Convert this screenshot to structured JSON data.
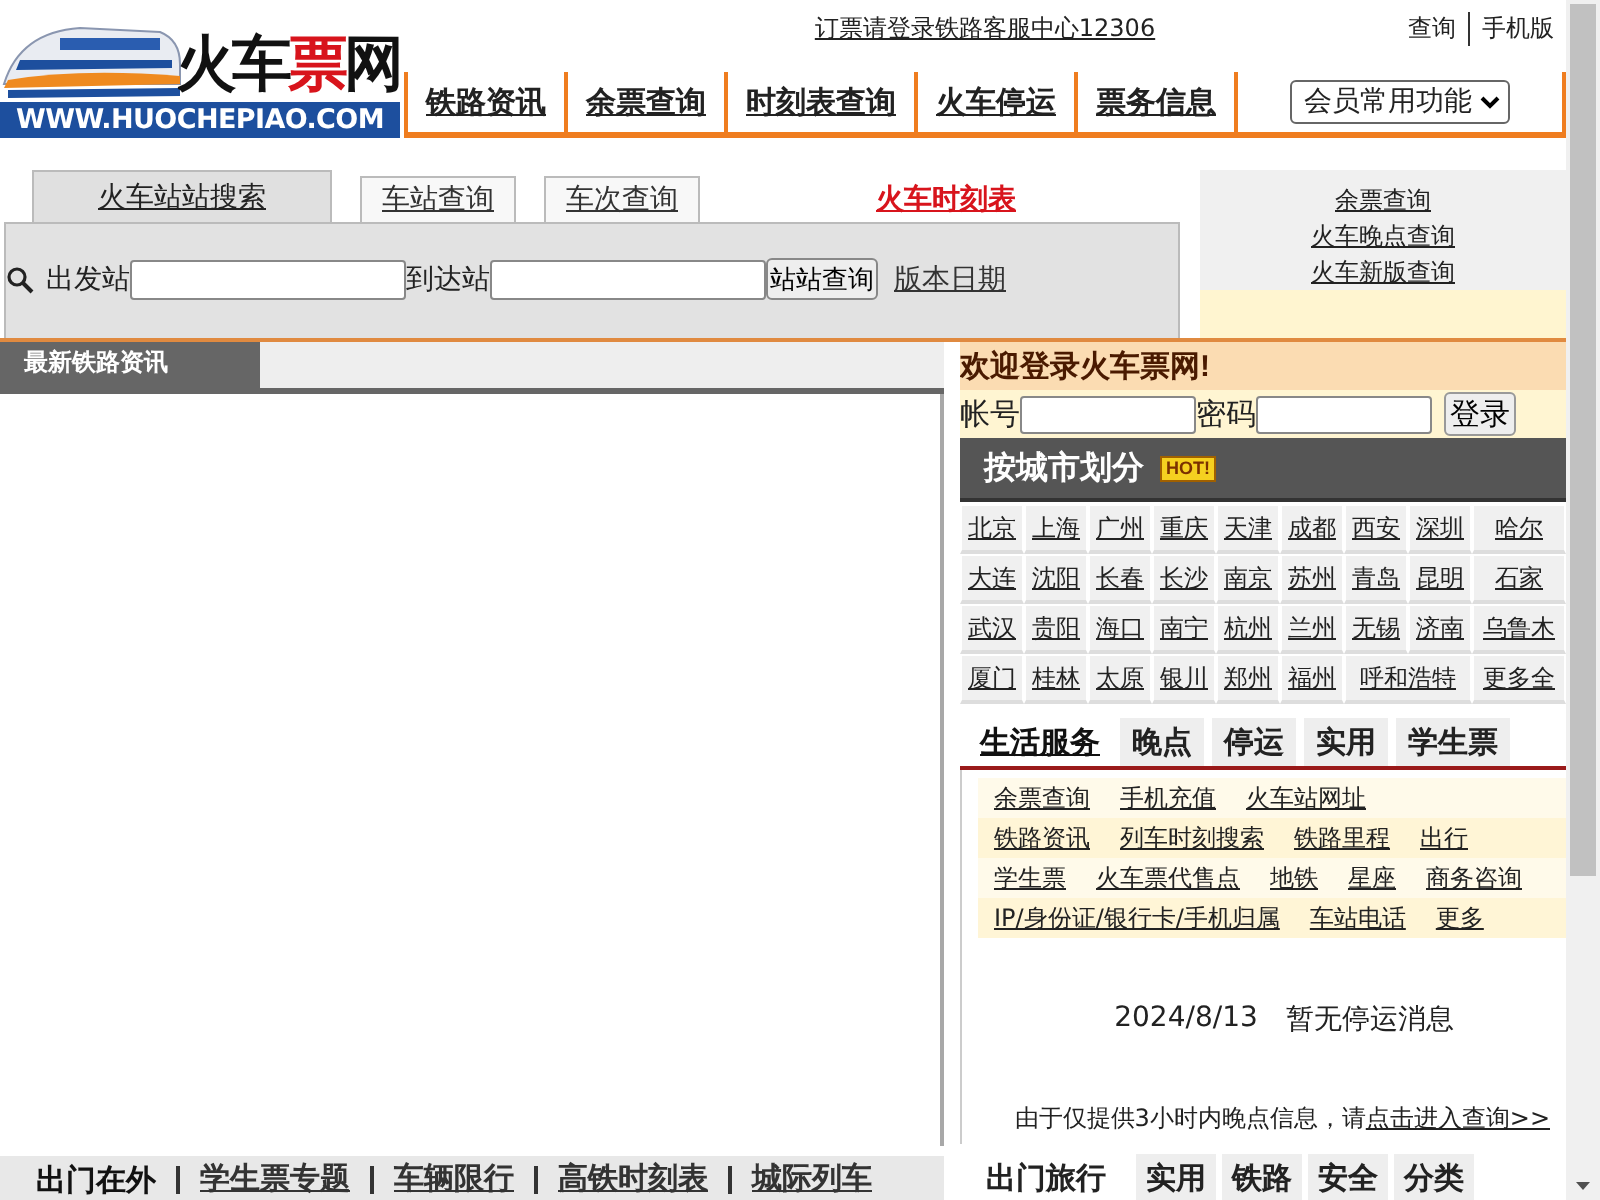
{
  "top_notice": "订票请登录铁路客服中心12306",
  "top_links": [
    "查询",
    "手机版"
  ],
  "logo": {
    "title_parts": [
      "火车",
      "票",
      "网"
    ],
    "url": "WWW.HUOCHEPIAO.COM"
  },
  "nav": [
    "铁路资讯",
    "余票查询",
    "时刻表查询",
    "火车停运",
    "票务信息"
  ],
  "member_select": "会员常用功能",
  "search": {
    "tabs": [
      {
        "label": "火车站站搜索",
        "selected": true
      },
      {
        "label": "车站查询",
        "selected": false
      },
      {
        "label": "车次查询",
        "selected": false
      }
    ],
    "timetable_link": "火车时刻表",
    "from_label": "出发站",
    "to_label": "到达站",
    "button": "站站查询",
    "version_link": "版本日期"
  },
  "quick_links": [
    "余票查询",
    "火车晚点查询",
    "火车新版查询"
  ],
  "news": {
    "title": "最新铁路资讯"
  },
  "login": {
    "welcome": "欢迎登录火车票网!",
    "account_label": "帐号",
    "password_label": "密码",
    "button": "登录"
  },
  "cities": {
    "title": "按城市划分",
    "badge": "HOT!",
    "links": [
      "北京",
      "上海",
      "广州",
      "重庆",
      "天津",
      "成都",
      "西安",
      "深圳",
      "哈尔",
      "大连",
      "沈阳",
      "长春",
      "长沙",
      "南京",
      "苏州",
      "青岛",
      "昆明",
      "石家",
      "武汉",
      "贵阳",
      "海口",
      "南宁",
      "杭州",
      "兰州",
      "无锡",
      "济南",
      "乌鲁木",
      "厦门",
      "桂林",
      "太原",
      "银川",
      "郑州",
      "福州",
      "呼和浩特",
      "更多全"
    ]
  },
  "service_tabs": [
    {
      "label": "生活服务",
      "selected": true
    },
    {
      "label": "晚点",
      "selected": false
    },
    {
      "label": "停运",
      "selected": false
    },
    {
      "label": "实用",
      "selected": false
    },
    {
      "label": "学生票",
      "selected": false
    }
  ],
  "service_links": [
    [
      "余票查询",
      "手机充值",
      "火车站网址"
    ],
    [
      "铁路资讯",
      "列车时刻搜索",
      "铁路里程",
      "出行"
    ],
    [
      "学生票",
      "火车票代售点",
      "地铁",
      "星座",
      "商务咨询"
    ],
    [
      "IP/身份证/银行卡/手机归属",
      "车站电话",
      "更多"
    ]
  ],
  "notice": {
    "date": "2024/8/13",
    "message": "暂无停运消息",
    "note": "由于仅提供3小时内晚点信息，请",
    "note_link": "点击进入查询>>"
  },
  "bottom_left": {
    "title": "出门在外",
    "links": [
      "学生票专题",
      "车辆限行",
      "高铁时刻表",
      "城际列车"
    ]
  },
  "bottom_tabs": [
    {
      "label": "出门旅行",
      "selected": true
    },
    {
      "label": "实用",
      "selected": false
    },
    {
      "label": "铁路",
      "selected": false
    },
    {
      "label": "安全",
      "selected": false
    },
    {
      "label": "分类",
      "selected": false
    }
  ]
}
